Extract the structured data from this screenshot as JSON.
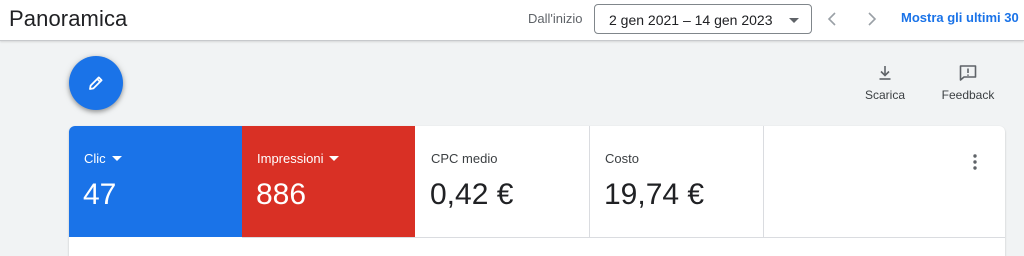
{
  "header": {
    "title": "Panoramica",
    "date_prefix": "Dall'inizio",
    "date_range": "2 gen 2021 – 14 gen 2023",
    "show_last": "Mostra gli ultimi 30"
  },
  "actions": {
    "edit_icon": "pencil-icon",
    "download_label": "Scarica",
    "feedback_label": "Feedback"
  },
  "metrics": [
    {
      "label": "Clic",
      "value": "47",
      "color": "#1a73e8",
      "dropdown": true
    },
    {
      "label": "Impressioni",
      "value": "886",
      "color": "#d93025",
      "dropdown": true
    },
    {
      "label": "CPC medio",
      "value": "0,42 €",
      "dropdown": false
    },
    {
      "label": "Costo",
      "value": "19,74 €",
      "dropdown": false
    }
  ],
  "colors": {
    "accent": "#1a73e8",
    "impressions": "#d93025",
    "background": "#f1f3f4"
  }
}
